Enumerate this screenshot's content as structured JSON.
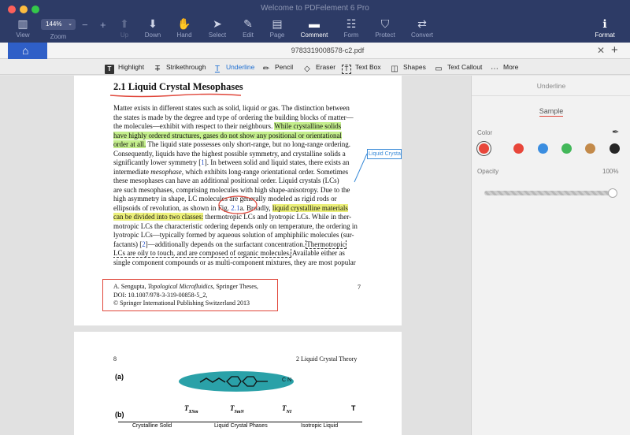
{
  "window": {
    "title": "Welcome to PDFelement 6 Pro"
  },
  "toolbar": {
    "zoom_value": "144%",
    "zoom_label": "Zoom",
    "items": [
      {
        "label": "View",
        "icon": "sidebar-view-icon"
      },
      {
        "label": "Up",
        "icon": "arrow-up-icon"
      },
      {
        "label": "Down",
        "icon": "arrow-down-icon"
      },
      {
        "label": "Hand",
        "icon": "hand-icon"
      },
      {
        "label": "Select",
        "icon": "cursor-icon"
      },
      {
        "label": "Edit",
        "icon": "edit-icon"
      },
      {
        "label": "Page",
        "icon": "page-icon"
      },
      {
        "label": "Comment",
        "icon": "comment-icon"
      },
      {
        "label": "Form",
        "icon": "form-icon"
      },
      {
        "label": "Protect",
        "icon": "protect-icon"
      },
      {
        "label": "Convert",
        "icon": "convert-icon"
      },
      {
        "label": "Format",
        "icon": "format-icon"
      }
    ]
  },
  "tabs": {
    "document": "9783319008578-c2.pdf"
  },
  "comment_toolbar": [
    {
      "label": "Highlight",
      "icon": "highlight-icon"
    },
    {
      "label": "Strikethrough",
      "icon": "strikethrough-icon"
    },
    {
      "label": "Underline",
      "icon": "underline-icon"
    },
    {
      "label": "Pencil",
      "icon": "pencil-icon"
    },
    {
      "label": "Eraser",
      "icon": "eraser-icon"
    },
    {
      "label": "Text Box",
      "icon": "textbox-icon"
    },
    {
      "label": "Shapes",
      "icon": "shapes-icon"
    },
    {
      "label": "Text Callout",
      "icon": "callout-icon"
    },
    {
      "label": "More",
      "icon": "more-icon"
    }
  ],
  "page1": {
    "heading": "2.1 Liquid Crystal Mesophases",
    "lines": [
      "Matter exists in different states such as solid, liquid or gas. The distinction between",
      "the states is made by the degree and type of ordering the building blocks of matter—",
      "the molecules—exhibit with respect to their neighbours.",
      "While crystalline solids",
      "have highly ordered structures, gases do not show any positional or orientational",
      "order at all.",
      " The liquid state possesses only short-range, but no long-range ordering.",
      "Consequently, liquids have the highest possible symmetry, and crystalline solids a",
      "significantly lower symmetry [",
      "1",
      "]. In between solid and liquid states, there exists an",
      "intermediate ",
      "mesophase",
      ", which exhibits long-range orientational order. Sometimes",
      "these mesophases can have an additional positional order. Liquid crystals (LCs)",
      "are such mesophases, comprising molecules with high shape-anisotropy. Due to the",
      "high asymmetry in shape, LC molecules are generally modeled as rigid rods or",
      "ellipsoids of revolution, as shown in Fig. ",
      "2.1",
      "a. Broadly, ",
      "liquid crystalline materials",
      "can be divided into two classes:",
      " thermotropic LCs and lyotropic LCs. While in ther-",
      "motropic LCs the characteristic ordering depends only on temperature, the ordering in",
      "lyotropic LCs—typically formed by aqueous solution of amphiphilic molecules (sur-",
      "factants) [",
      "2",
      "]—additionally depends on the surfactant concentration. ",
      "Thermotropic",
      "LCs are oily to touch, and are composed of organic molecules.",
      " Available either as",
      "single component compounds or as multi-component mixtures, they are most popular"
    ],
    "footnote": [
      "A. Sengupta, ",
      "Topological Microfluidics",
      ", Springer Theses,",
      "DOI: 10.1007/978-3-319-00858-5_2,",
      "© Springer International Publishing Switzerland 2013"
    ],
    "page_number": "7",
    "callout_text": "Liquid Crysta"
  },
  "page2": {
    "page_number": "8",
    "running_head": "2   Liquid Crystal Theory",
    "panel_a": "(a)",
    "panel_b": "(b)",
    "molecule_label": "C N",
    "axis": {
      "t_xsm": "T",
      "t_xsm_sub": "XSm",
      "t_smn": "T",
      "t_smn_sub": "SmN",
      "t_ni": "T",
      "t_ni_sub": "NI",
      "t": "T",
      "phases": [
        "Crystalline Solid",
        "Liquid Crystal Phases",
        "Isotropic Liquid"
      ]
    }
  },
  "panel": {
    "title": "Underline",
    "sample": "Sample",
    "color_label": "Color",
    "opacity_label": "Opacity",
    "opacity_value": "100%",
    "opacity_level": 1.0,
    "swatches": [
      "#e8463a",
      "#e8463a",
      "#3a8de0",
      "#43b85a",
      "#c38a4a",
      "#262626"
    ],
    "selected_swatch": 0
  },
  "colors": {
    "toolbar_bg": "#2d3b66",
    "accent": "#2f5fc7",
    "highlight_yellow": "#ecf07a",
    "highlight_green": "#c4ee8c",
    "annotation_red": "#e0473b",
    "callout_blue": "#3a8bd8"
  }
}
